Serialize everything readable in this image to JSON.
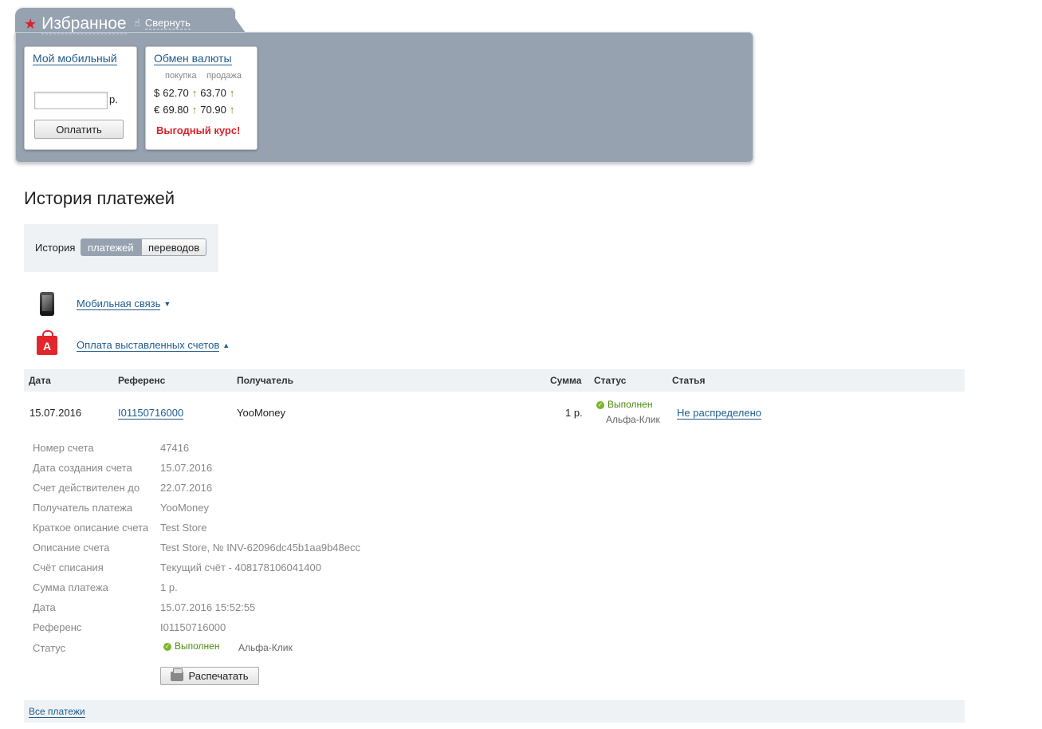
{
  "favorites": {
    "title": "Избранное",
    "collapse_label": "Свернуть",
    "mobile_card": {
      "title": "Мой мобильный",
      "amount_value": "",
      "currency_suffix": "р.",
      "pay_label": "Оплатить"
    },
    "fx_card": {
      "title": "Обмен валюты",
      "buy_label": "покупка",
      "sell_label": "продажа",
      "rates": [
        {
          "symbol": "$",
          "buy": "62.70",
          "sell": "63.70"
        },
        {
          "symbol": "€",
          "buy": "69.80",
          "sell": "70.90"
        }
      ],
      "arrow": "↑",
      "promo": "Выгодный курс!"
    }
  },
  "history": {
    "title": "История платежей",
    "switch_label": "История",
    "tab_payments": "платежей",
    "tab_transfers": "переводов",
    "categories": [
      {
        "label": "Мобильная связь",
        "arrow": "▼"
      },
      {
        "label": "Оплата выставленных счетов",
        "arrow": "▲"
      }
    ],
    "bag_letter": "A",
    "columns": {
      "date": "Дата",
      "reference": "Референс",
      "recipient": "Получатель",
      "amount": "Сумма",
      "status": "Статус",
      "article": "Статья"
    },
    "row": {
      "date": "15.07.2016",
      "reference": "I01150716000",
      "recipient": "YooMoney",
      "amount": "1 р.",
      "status": "Выполнен",
      "status_source": "Альфа-Клик",
      "article": "Не распределено"
    },
    "details": [
      {
        "label": "Номер счета",
        "value": "47416"
      },
      {
        "label": "Дата создания счета",
        "value": "15.07.2016"
      },
      {
        "label": "Счет действителен до",
        "value": "22.07.2016"
      },
      {
        "label": "Получатель платежа",
        "value": "YooMoney"
      },
      {
        "label": "Краткое описание счета",
        "value": "Test Store"
      },
      {
        "label": "Описание счета",
        "value": "Test Store, № INV-62096dc45b1aa9b48ecc"
      },
      {
        "label": "Счёт списания",
        "value": "Текущий счёт - 408178106041400"
      },
      {
        "label": "Сумма платежа",
        "value": "1 р."
      },
      {
        "label": "Дата",
        "value": "15.07.2016 15:52:55"
      },
      {
        "label": "Референс",
        "value": "I01150716000"
      }
    ],
    "detail_status_label": "Статус",
    "detail_status_value": "Выполнен",
    "detail_status_source": "Альфа-Клик",
    "print_label": "Распечатать",
    "all_payments": "Все платежи"
  },
  "icons": {
    "star": "star-icon",
    "hand": "hand-icon",
    "phone": "phone-icon",
    "bag": "shopping-bag-icon",
    "check": "check-icon",
    "printer": "printer-icon"
  },
  "colors": {
    "panel": "#96a2b0",
    "accent_red": "#d8232a",
    "link": "#1f5c8c",
    "ok_green": "#7cb52a"
  }
}
